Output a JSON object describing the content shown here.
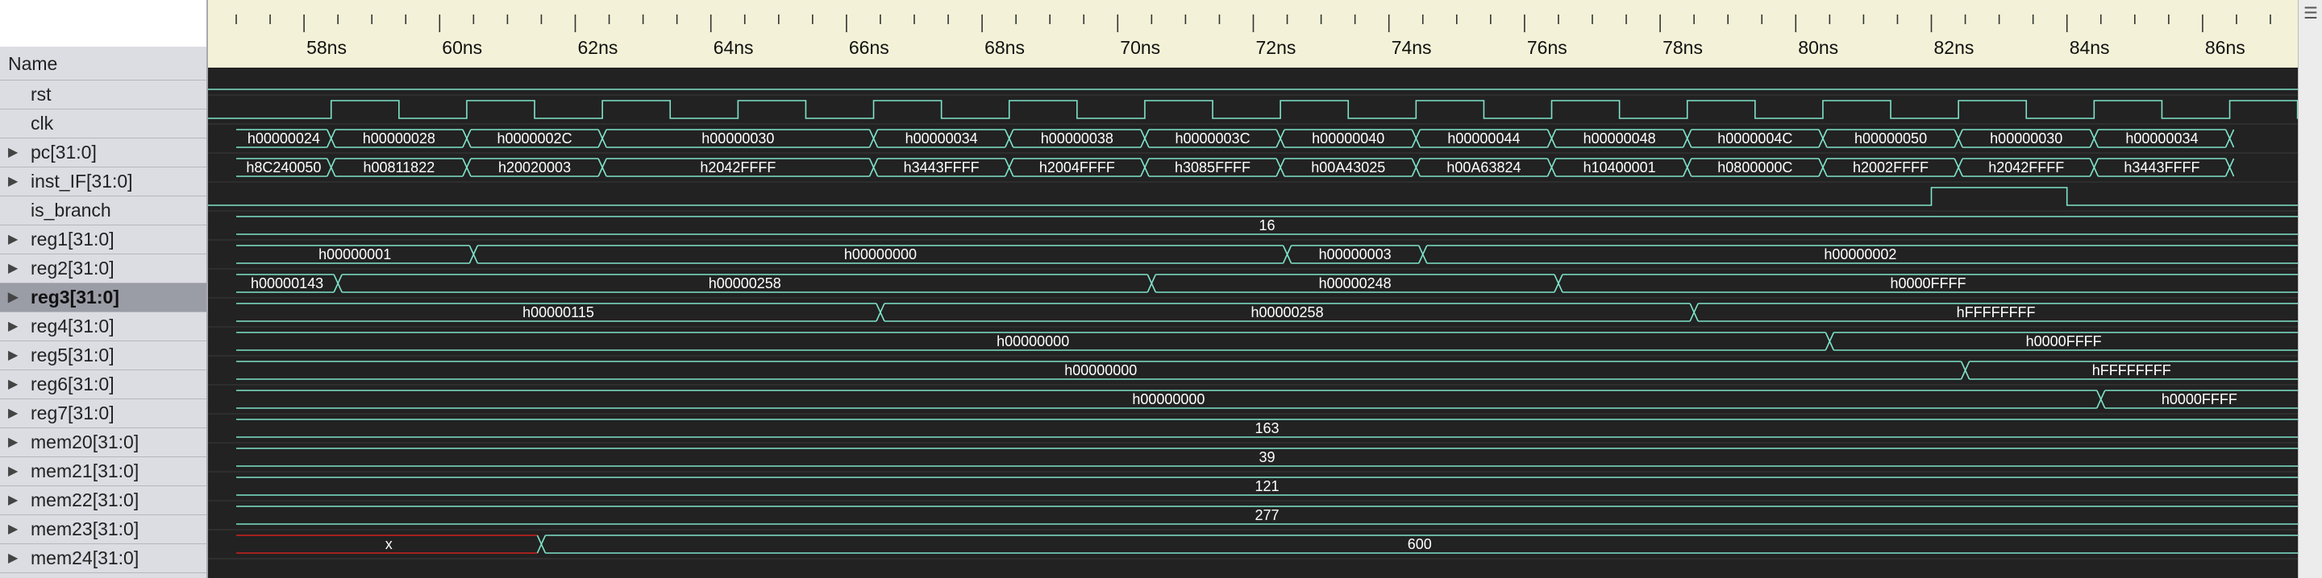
{
  "names_header": "Name",
  "time_ruler": {
    "labels": [
      "58ns",
      "60ns",
      "62ns",
      "64ns",
      "66ns",
      "68ns",
      "70ns",
      "72ns",
      "74ns",
      "76ns",
      "78ns",
      "80ns",
      "82ns",
      "84ns",
      "86ns"
    ]
  },
  "signals": [
    {
      "name": "rst",
      "expandable": false
    },
    {
      "name": "clk",
      "expandable": false
    },
    {
      "name": "pc[31:0]",
      "expandable": true
    },
    {
      "name": "inst_IF[31:0]",
      "expandable": true
    },
    {
      "name": "is_branch",
      "expandable": false
    },
    {
      "name": "reg1[31:0]",
      "expandable": true
    },
    {
      "name": "reg2[31:0]",
      "expandable": true
    },
    {
      "name": "reg3[31:0]",
      "expandable": true,
      "selected": true
    },
    {
      "name": "reg4[31:0]",
      "expandable": true
    },
    {
      "name": "reg5[31:0]",
      "expandable": true
    },
    {
      "name": "reg6[31:0]",
      "expandable": true
    },
    {
      "name": "reg7[31:0]",
      "expandable": true
    },
    {
      "name": "mem20[31:0]",
      "expandable": true
    },
    {
      "name": "mem21[31:0]",
      "expandable": true
    },
    {
      "name": "mem22[31:0]",
      "expandable": true
    },
    {
      "name": "mem23[31:0]",
      "expandable": true
    },
    {
      "name": "mem24[31:0]",
      "expandable": true
    }
  ],
  "waveforms": {
    "pc": {
      "transitions_ns": [
        57.0,
        58.4,
        60.4,
        62.4,
        66.4,
        68.4,
        70.4,
        72.4,
        74.4,
        76.4,
        78.4,
        80.4,
        82.4,
        84.4,
        86.4
      ],
      "values": [
        "h00000024",
        "h00000028",
        "h0000002C",
        "h00000030",
        "h00000034",
        "h00000038",
        "h0000003C",
        "h00000040",
        "h00000044",
        "h00000048",
        "h0000004C",
        "h00000050",
        "h00000030",
        "h00000034"
      ]
    },
    "inst_IF": {
      "transitions_ns": [
        57.0,
        58.4,
        60.4,
        62.4,
        66.4,
        68.4,
        70.4,
        72.4,
        74.4,
        76.4,
        78.4,
        80.4,
        82.4,
        84.4,
        86.4
      ],
      "values": [
        "h8C240050",
        "h00811822",
        "h20020003",
        "h2042FFFF",
        "h3443FFFF",
        "h2004FFFF",
        "h3085FFFF",
        "h00A43025",
        "h00A63824",
        "h10400001",
        "h0800000C",
        "h2002FFFF",
        "h2042FFFF",
        "h3443FFFF"
      ]
    },
    "is_branch": {
      "high_from_ns": 82.0,
      "high_to_ns": 84.0
    },
    "reg1": {
      "transitions_ns": [
        57.0
      ],
      "values": [
        "16"
      ]
    },
    "reg2": {
      "transitions_ns": [
        57.0,
        60.5,
        72.5,
        74.5
      ],
      "values": [
        "h00000001",
        "h00000000",
        "h00000003",
        "h00000002"
      ]
    },
    "reg3": {
      "transitions_ns": [
        57.0,
        58.5,
        70.5,
        76.5
      ],
      "values": [
        "h00000143",
        "h00000258",
        "h00000248",
        "h0000FFFF"
      ]
    },
    "reg4": {
      "transitions_ns": [
        57.0,
        66.5,
        78.5
      ],
      "values": [
        "h00000115",
        "h00000258",
        "hFFFFFFFF"
      ]
    },
    "reg5": {
      "transitions_ns": [
        57.0,
        80.5
      ],
      "values": [
        "h00000000",
        "h0000FFFF"
      ]
    },
    "reg6": {
      "transitions_ns": [
        57.0,
        82.5
      ],
      "values": [
        "h00000000",
        "hFFFFFFFF"
      ]
    },
    "reg7": {
      "transitions_ns": [
        57.0,
        84.5
      ],
      "values": [
        "h00000000",
        "h0000FFFF"
      ]
    },
    "mem20": {
      "transitions_ns": [
        57.0
      ],
      "values": [
        "163"
      ]
    },
    "mem21": {
      "transitions_ns": [
        57.0
      ],
      "values": [
        "39"
      ]
    },
    "mem22": {
      "transitions_ns": [
        57.0
      ],
      "values": [
        "121"
      ]
    },
    "mem23": {
      "transitions_ns": [
        57.0
      ],
      "values": [
        "277"
      ]
    },
    "mem24": {
      "transitions_ns": [
        57.0,
        61.5
      ],
      "values": [
        "x",
        "600"
      ],
      "unknown_until_ns": 61.5
    }
  },
  "colors": {
    "wave": "#7fe3c9",
    "unknown": "#d0211c",
    "canvas_bg": "#222222",
    "ruler_bg": "#f3f2d8",
    "selected_row": "#9a9ca6"
  }
}
